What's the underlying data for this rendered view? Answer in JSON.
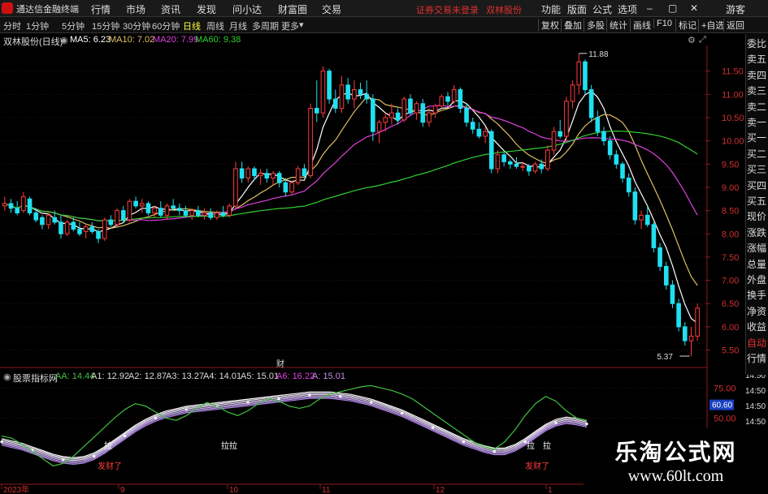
{
  "app": {
    "name": "通达信金融终端",
    "notice": "证券交易未登录",
    "stock_title": "双林股份"
  },
  "menu": {
    "left": [
      "行情",
      "市场",
      "资讯",
      "发现",
      "问小达",
      "财富圈",
      "交易"
    ],
    "right": [
      "功能",
      "版面",
      "公式",
      "选项",
      "游客"
    ]
  },
  "period_tabs": [
    "分时",
    "1分钟",
    "5分钟",
    "15分钟",
    "30分钟",
    "60分钟",
    "日线",
    "周线",
    "月线",
    "多周期",
    "更多"
  ],
  "active_period": "日线",
  "toolbar": [
    "复权",
    "叠加",
    "多股",
    "统计",
    "画线",
    "F10",
    "标记",
    "+自选",
    "返回"
  ],
  "main_indicator": {
    "stock_label": "双林股份(日线)",
    "ma5": "MA5: 6.23",
    "ma10": "MA10: 7.02",
    "ma20": "MA20: 7.99",
    "ma60": "MA60: 9.38"
  },
  "colors": {
    "up": "#ff3c3c",
    "down": "#20e0f0",
    "ma5": "#ffffff",
    "ma10": "#e0c060",
    "ma20": "#e040e0",
    "ma60": "#30d030",
    "ind_green": "#40c040",
    "ind_band": "#c090e0"
  },
  "annotations": {
    "high": "11.88",
    "low": "5.37",
    "cai": "财",
    "la1": "拉",
    "la2": "拉拉",
    "la3": "拉",
    "la4": "拉",
    "fa1": "发财了",
    "fa2": "发财了"
  },
  "right_panel": [
    "委比",
    "卖五",
    "卖四",
    "卖三",
    "卖二",
    "卖一",
    "买一",
    "买二",
    "买三",
    "买四",
    "买五",
    "现价",
    "涨跌",
    "涨幅",
    "总量",
    "外盘",
    "换手",
    "净资",
    "收益",
    "自动",
    "行情"
  ],
  "right_panel_selected": "自动",
  "time_labels": [
    "14:50",
    "14:50",
    "14:50",
    "14:50",
    "14:50",
    "14:50",
    "14:50",
    "14:50",
    "14:50"
  ],
  "sub_indicator": {
    "name": "股票指标网",
    "aa": "AA: 14.44",
    "a1": "A1: 12.92",
    "a2": "A2: 12.87",
    "a3": "A3: 13.27",
    "a4": "A4: 14.01",
    "a5": "A5: 15.01",
    "a6": "A6: 16.22",
    "a": "A: 15.01",
    "cursor_value": "60.60"
  },
  "watermark": {
    "title": "乐淘公式网",
    "url": "www.60lt.com"
  },
  "chart_data": [
    {
      "type": "candlestick",
      "title": "双林股份(日线)",
      "y_ticks": [
        11.5,
        11.0,
        10.5,
        10.0,
        9.5,
        9.0,
        8.5,
        8.0,
        7.5,
        7.0,
        6.5,
        6.0,
        5.5
      ],
      "ylim": [
        5.3,
        12.0
      ],
      "x_labels": [
        "2023年",
        "9",
        "10",
        "11",
        "12",
        "1"
      ],
      "price_high_mark": 11.88,
      "price_low_mark": 5.37,
      "candles": [
        [
          8.6,
          8.8,
          8.5,
          8.65
        ],
        [
          8.65,
          8.75,
          8.45,
          8.55
        ],
        [
          8.55,
          8.7,
          8.4,
          8.45
        ],
        [
          8.5,
          8.9,
          8.45,
          8.8
        ],
        [
          8.75,
          8.8,
          8.4,
          8.45
        ],
        [
          8.45,
          8.55,
          8.25,
          8.3
        ],
        [
          8.35,
          8.4,
          8.1,
          8.2
        ],
        [
          8.2,
          8.45,
          8.1,
          8.4
        ],
        [
          8.35,
          8.5,
          8.2,
          8.25
        ],
        [
          8.25,
          8.4,
          7.9,
          8.0
        ],
        [
          8.0,
          8.3,
          7.95,
          8.25
        ],
        [
          8.25,
          8.35,
          8.05,
          8.1
        ],
        [
          8.1,
          8.25,
          7.95,
          8.0
        ],
        [
          8.05,
          8.2,
          7.9,
          8.15
        ],
        [
          8.15,
          8.25,
          8.0,
          8.05
        ],
        [
          8.05,
          8.1,
          7.8,
          7.9
        ],
        [
          7.9,
          8.35,
          7.85,
          8.3
        ],
        [
          8.3,
          8.4,
          8.15,
          8.2
        ],
        [
          8.2,
          8.55,
          8.15,
          8.5
        ],
        [
          8.5,
          8.6,
          8.25,
          8.3
        ],
        [
          8.3,
          8.75,
          8.25,
          8.7
        ],
        [
          8.7,
          8.8,
          8.55,
          8.6
        ],
        [
          8.6,
          8.75,
          8.45,
          8.65
        ],
        [
          8.65,
          8.7,
          8.4,
          8.45
        ],
        [
          8.45,
          8.6,
          8.35,
          8.55
        ],
        [
          8.55,
          8.7,
          8.35,
          8.4
        ],
        [
          8.4,
          8.65,
          8.3,
          8.6
        ],
        [
          8.6,
          8.75,
          8.5,
          8.55
        ],
        [
          8.55,
          8.65,
          8.4,
          8.5
        ],
        [
          8.5,
          8.6,
          8.35,
          8.4
        ],
        [
          8.4,
          8.55,
          8.3,
          8.5
        ],
        [
          8.5,
          8.6,
          8.35,
          8.4
        ],
        [
          8.4,
          8.55,
          8.3,
          8.45
        ],
        [
          8.45,
          8.55,
          8.3,
          8.35
        ],
        [
          8.35,
          8.5,
          8.3,
          8.45
        ],
        [
          8.45,
          8.6,
          8.35,
          8.4
        ],
        [
          8.4,
          8.65,
          8.35,
          8.6
        ],
        [
          8.6,
          9.55,
          8.55,
          9.4
        ],
        [
          9.4,
          9.55,
          9.1,
          9.2
        ],
        [
          9.2,
          9.45,
          9.1,
          9.4
        ],
        [
          9.4,
          9.45,
          9.15,
          9.25
        ],
        [
          9.25,
          9.4,
          9.05,
          9.3
        ],
        [
          9.3,
          9.4,
          9.1,
          9.2
        ],
        [
          9.2,
          9.35,
          9.05,
          9.3
        ],
        [
          9.3,
          9.35,
          9.0,
          9.1
        ],
        [
          9.1,
          9.2,
          8.8,
          8.9
        ],
        [
          8.9,
          9.15,
          8.85,
          9.1
        ],
        [
          9.1,
          9.45,
          9.05,
          9.4
        ],
        [
          9.4,
          9.5,
          9.2,
          9.25
        ],
        [
          9.25,
          10.8,
          9.2,
          10.7
        ],
        [
          10.7,
          11.3,
          10.4,
          10.6
        ],
        [
          10.6,
          11.6,
          10.5,
          11.5
        ],
        [
          11.5,
          11.55,
          10.8,
          10.9
        ],
        [
          10.9,
          11.1,
          10.6,
          10.7
        ],
        [
          10.7,
          11.4,
          10.6,
          11.2
        ],
        [
          11.2,
          11.35,
          10.8,
          10.9
        ],
        [
          10.9,
          11.3,
          10.7,
          11.1
        ],
        [
          11.1,
          11.25,
          10.9,
          11.0
        ],
        [
          11.0,
          11.3,
          10.8,
          10.9
        ],
        [
          10.9,
          11.0,
          10.0,
          10.2
        ],
        [
          10.2,
          10.45,
          9.95,
          10.4
        ],
        [
          10.4,
          10.6,
          10.2,
          10.5
        ],
        [
          10.5,
          10.8,
          10.35,
          10.6
        ],
        [
          10.6,
          10.7,
          10.35,
          10.45
        ],
        [
          10.45,
          10.95,
          10.4,
          10.9
        ],
        [
          10.9,
          11.0,
          10.55,
          10.6
        ],
        [
          10.6,
          10.85,
          10.45,
          10.8
        ],
        [
          10.8,
          10.9,
          10.3,
          10.4
        ],
        [
          10.4,
          10.7,
          10.3,
          10.6
        ],
        [
          10.6,
          10.8,
          10.5,
          10.75
        ],
        [
          10.75,
          11.0,
          10.7,
          10.95
        ],
        [
          10.95,
          11.05,
          10.75,
          10.85
        ],
        [
          10.85,
          11.2,
          10.8,
          11.1
        ],
        [
          11.1,
          11.15,
          10.6,
          10.7
        ],
        [
          10.7,
          10.8,
          10.3,
          10.4
        ],
        [
          10.4,
          10.5,
          10.15,
          10.25
        ],
        [
          10.25,
          10.4,
          10.05,
          10.1
        ],
        [
          10.1,
          10.3,
          9.95,
          10.2
        ],
        [
          10.2,
          10.25,
          9.3,
          9.4
        ],
        [
          9.4,
          9.8,
          9.3,
          9.7
        ],
        [
          9.7,
          9.75,
          9.45,
          9.55
        ],
        [
          9.55,
          9.6,
          9.4,
          9.5
        ],
        [
          9.5,
          9.65,
          9.4,
          9.45
        ],
        [
          9.45,
          9.55,
          9.35,
          9.45
        ],
        [
          9.45,
          9.5,
          9.25,
          9.35
        ],
        [
          9.35,
          9.55,
          9.3,
          9.5
        ],
        [
          9.5,
          9.6,
          9.3,
          9.4
        ],
        [
          9.4,
          9.9,
          9.35,
          9.8
        ],
        [
          9.8,
          10.3,
          9.7,
          10.2
        ],
        [
          10.2,
          10.45,
          10.05,
          10.1
        ],
        [
          10.1,
          10.95,
          10.0,
          10.85
        ],
        [
          10.85,
          11.3,
          10.7,
          11.2
        ],
        [
          11.2,
          11.88,
          11.0,
          11.7
        ],
        [
          11.7,
          11.75,
          11.0,
          11.1
        ],
        [
          11.1,
          11.2,
          10.4,
          10.5
        ],
        [
          10.5,
          10.65,
          10.1,
          10.2
        ],
        [
          10.2,
          10.3,
          9.9,
          10.0
        ],
        [
          10.0,
          10.1,
          9.6,
          9.7
        ],
        [
          9.7,
          9.8,
          9.4,
          9.5
        ],
        [
          9.5,
          9.55,
          9.1,
          9.2
        ],
        [
          9.2,
          9.3,
          8.8,
          8.9
        ],
        [
          8.9,
          9.0,
          8.2,
          8.3
        ],
        [
          8.3,
          8.5,
          8.1,
          8.4
        ],
        [
          8.4,
          8.6,
          8.15,
          8.2
        ],
        [
          8.2,
          8.25,
          7.6,
          7.7
        ],
        [
          7.7,
          7.8,
          7.2,
          7.3
        ],
        [
          7.3,
          7.4,
          6.8,
          6.9
        ],
        [
          6.9,
          7.0,
          6.4,
          6.5
        ],
        [
          6.5,
          6.6,
          5.9,
          6.0
        ],
        [
          6.0,
          6.1,
          5.6,
          5.7
        ],
        [
          5.7,
          6.0,
          5.37,
          5.8
        ],
        [
          5.8,
          6.5,
          5.7,
          6.4
        ]
      ],
      "series": [
        {
          "name": "MA5",
          "value_last": 6.23
        },
        {
          "name": "MA10",
          "value_last": 7.02
        },
        {
          "name": "MA20",
          "value_last": 7.99
        },
        {
          "name": "MA60",
          "value_last": 9.38
        }
      ]
    },
    {
      "type": "line",
      "title": "股票指标网",
      "y_ticks": [
        75.0,
        60.6,
        50.0
      ],
      "ylim": [
        0,
        80
      ],
      "series": [
        {
          "name": "AA",
          "values": [
            35,
            33,
            28,
            22,
            16,
            10,
            12,
            18,
            26,
            34,
            42,
            50,
            57,
            62,
            60,
            55,
            50,
            48,
            52,
            58,
            63,
            60,
            55,
            52,
            56,
            62,
            66,
            64,
            60,
            58,
            60,
            66,
            70,
            72,
            74,
            76,
            77,
            75,
            73,
            70,
            66,
            60,
            54,
            48,
            42,
            36,
            30,
            26,
            24,
            30,
            40,
            52,
            62,
            68,
            64,
            56,
            50,
            48
          ]
        },
        {
          "name": "A",
          "values": [
            30,
            28,
            26,
            23,
            20,
            17,
            15,
            14,
            15,
            18,
            23,
            29,
            35,
            41,
            46,
            50,
            53,
            55,
            57,
            58,
            59,
            60,
            61,
            62,
            63,
            64,
            65,
            66,
            67,
            68,
            69,
            69,
            69,
            68,
            67,
            65,
            63,
            60,
            57,
            54,
            50,
            46,
            42,
            38,
            34,
            30,
            27,
            24,
            22,
            22,
            25,
            30,
            36,
            42,
            46,
            48,
            47,
            45
          ]
        }
      ],
      "markers_bottom": [
        "拉",
        "拉拉",
        "拉",
        "拉"
      ]
    }
  ]
}
